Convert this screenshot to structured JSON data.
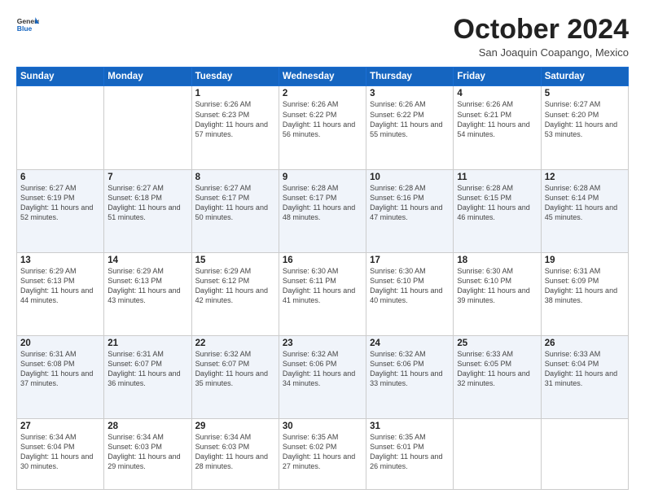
{
  "header": {
    "logo_general": "General",
    "logo_blue": "Blue",
    "month_title": "October 2024",
    "location": "San Joaquin Coapango, Mexico"
  },
  "weekdays": [
    "Sunday",
    "Monday",
    "Tuesday",
    "Wednesday",
    "Thursday",
    "Friday",
    "Saturday"
  ],
  "weeks": [
    [
      {
        "day": "",
        "info": ""
      },
      {
        "day": "",
        "info": ""
      },
      {
        "day": "1",
        "info": "Sunrise: 6:26 AM\nSunset: 6:23 PM\nDaylight: 11 hours and 57 minutes."
      },
      {
        "day": "2",
        "info": "Sunrise: 6:26 AM\nSunset: 6:22 PM\nDaylight: 11 hours and 56 minutes."
      },
      {
        "day": "3",
        "info": "Sunrise: 6:26 AM\nSunset: 6:22 PM\nDaylight: 11 hours and 55 minutes."
      },
      {
        "day": "4",
        "info": "Sunrise: 6:26 AM\nSunset: 6:21 PM\nDaylight: 11 hours and 54 minutes."
      },
      {
        "day": "5",
        "info": "Sunrise: 6:27 AM\nSunset: 6:20 PM\nDaylight: 11 hours and 53 minutes."
      }
    ],
    [
      {
        "day": "6",
        "info": "Sunrise: 6:27 AM\nSunset: 6:19 PM\nDaylight: 11 hours and 52 minutes."
      },
      {
        "day": "7",
        "info": "Sunrise: 6:27 AM\nSunset: 6:18 PM\nDaylight: 11 hours and 51 minutes."
      },
      {
        "day": "8",
        "info": "Sunrise: 6:27 AM\nSunset: 6:17 PM\nDaylight: 11 hours and 50 minutes."
      },
      {
        "day": "9",
        "info": "Sunrise: 6:28 AM\nSunset: 6:17 PM\nDaylight: 11 hours and 48 minutes."
      },
      {
        "day": "10",
        "info": "Sunrise: 6:28 AM\nSunset: 6:16 PM\nDaylight: 11 hours and 47 minutes."
      },
      {
        "day": "11",
        "info": "Sunrise: 6:28 AM\nSunset: 6:15 PM\nDaylight: 11 hours and 46 minutes."
      },
      {
        "day": "12",
        "info": "Sunrise: 6:28 AM\nSunset: 6:14 PM\nDaylight: 11 hours and 45 minutes."
      }
    ],
    [
      {
        "day": "13",
        "info": "Sunrise: 6:29 AM\nSunset: 6:13 PM\nDaylight: 11 hours and 44 minutes."
      },
      {
        "day": "14",
        "info": "Sunrise: 6:29 AM\nSunset: 6:13 PM\nDaylight: 11 hours and 43 minutes."
      },
      {
        "day": "15",
        "info": "Sunrise: 6:29 AM\nSunset: 6:12 PM\nDaylight: 11 hours and 42 minutes."
      },
      {
        "day": "16",
        "info": "Sunrise: 6:30 AM\nSunset: 6:11 PM\nDaylight: 11 hours and 41 minutes."
      },
      {
        "day": "17",
        "info": "Sunrise: 6:30 AM\nSunset: 6:10 PM\nDaylight: 11 hours and 40 minutes."
      },
      {
        "day": "18",
        "info": "Sunrise: 6:30 AM\nSunset: 6:10 PM\nDaylight: 11 hours and 39 minutes."
      },
      {
        "day": "19",
        "info": "Sunrise: 6:31 AM\nSunset: 6:09 PM\nDaylight: 11 hours and 38 minutes."
      }
    ],
    [
      {
        "day": "20",
        "info": "Sunrise: 6:31 AM\nSunset: 6:08 PM\nDaylight: 11 hours and 37 minutes."
      },
      {
        "day": "21",
        "info": "Sunrise: 6:31 AM\nSunset: 6:07 PM\nDaylight: 11 hours and 36 minutes."
      },
      {
        "day": "22",
        "info": "Sunrise: 6:32 AM\nSunset: 6:07 PM\nDaylight: 11 hours and 35 minutes."
      },
      {
        "day": "23",
        "info": "Sunrise: 6:32 AM\nSunset: 6:06 PM\nDaylight: 11 hours and 34 minutes."
      },
      {
        "day": "24",
        "info": "Sunrise: 6:32 AM\nSunset: 6:06 PM\nDaylight: 11 hours and 33 minutes."
      },
      {
        "day": "25",
        "info": "Sunrise: 6:33 AM\nSunset: 6:05 PM\nDaylight: 11 hours and 32 minutes."
      },
      {
        "day": "26",
        "info": "Sunrise: 6:33 AM\nSunset: 6:04 PM\nDaylight: 11 hours and 31 minutes."
      }
    ],
    [
      {
        "day": "27",
        "info": "Sunrise: 6:34 AM\nSunset: 6:04 PM\nDaylight: 11 hours and 30 minutes."
      },
      {
        "day": "28",
        "info": "Sunrise: 6:34 AM\nSunset: 6:03 PM\nDaylight: 11 hours and 29 minutes."
      },
      {
        "day": "29",
        "info": "Sunrise: 6:34 AM\nSunset: 6:03 PM\nDaylight: 11 hours and 28 minutes."
      },
      {
        "day": "30",
        "info": "Sunrise: 6:35 AM\nSunset: 6:02 PM\nDaylight: 11 hours and 27 minutes."
      },
      {
        "day": "31",
        "info": "Sunrise: 6:35 AM\nSunset: 6:01 PM\nDaylight: 11 hours and 26 minutes."
      },
      {
        "day": "",
        "info": ""
      },
      {
        "day": "",
        "info": ""
      }
    ]
  ]
}
